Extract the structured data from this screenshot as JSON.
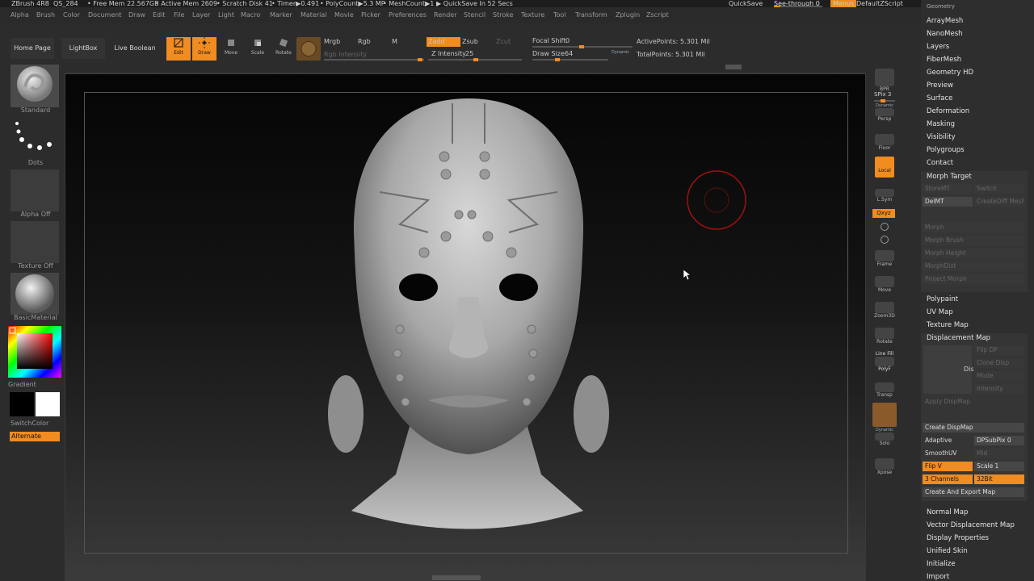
{
  "titlebar": {
    "app": "ZBrush 4R8",
    "project": "QS_284",
    "free_mem": "• Free Mem 22.567GB",
    "active_mem": "• Active Mem 2609",
    "scratch": "• Scratch Disk 41",
    "timer": "• Timer▶0.491",
    "polycount": "• PolyCount▶5.3 MP",
    "meshcount": "• MeshCount▶1",
    "quicksave_in": "▶ QuickSave In 52 Secs",
    "quicksave": "QuickSave",
    "see_through": "See-through  0",
    "menus": "Menus",
    "script": "DefaultZScript"
  },
  "menubar": [
    "Alpha",
    "Brush",
    "Color",
    "Document",
    "Draw",
    "Edit",
    "File",
    "Layer",
    "Light",
    "Macro",
    "Marker",
    "Material",
    "Movie",
    "Picker",
    "Preferences",
    "Render",
    "Stencil",
    "Stroke",
    "Texture",
    "Tool",
    "Transform",
    "Zplugin",
    "Zscript"
  ],
  "toolbar": {
    "home_page": "Home Page",
    "lightbox": "LightBox",
    "live_boolean": "Live Boolean",
    "edit": "Edit",
    "draw": "Draw",
    "move": "Move",
    "scale": "Scale",
    "rotate": "Rotate",
    "mrgb": "Mrgb",
    "rgb": "Rgb",
    "m": "M",
    "rgb_intensity": "Rgb Intensity",
    "zadd": "Zadd",
    "zsub": "Zsub",
    "zcut": "Zcut",
    "z_intensity_label": "Z Intensity",
    "z_intensity_value": "25",
    "focal_shift_label": "Focal Shift",
    "focal_shift_value": "0",
    "draw_size_label": "Draw Size",
    "draw_size_value": "64",
    "dynamic": "Dynamic",
    "active_points": "ActivePoints: 5.301 Mil",
    "total_points": "TotalPoints: 5.301 Mil"
  },
  "leftshelf": {
    "brush": "Standard",
    "stroke": "Dots",
    "alpha": "Alpha Off",
    "texture": "Texture Off",
    "material": "BasicMaterial",
    "gradient": "Gradient",
    "switch_color": "SwitchColor",
    "alternate": "Alternate"
  },
  "rightshelf": {
    "bpr": "BPR",
    "spix_label": "SPix",
    "spix_value": "3",
    "dynamic": "Dynamic",
    "persp": "Persp",
    "floor": "Floor",
    "local": "Local",
    "lsym": "L.Sym",
    "qxyz": "Qxyz",
    "frame": "Frame",
    "move": "Move",
    "zoom3d": "Zoom3D",
    "rotate": "Rotate",
    "line_fill": "Line Fill",
    "polyf": "PolyF",
    "transp": "Transp",
    "dynamic2": "Dynamic",
    "solo": "Solo",
    "xpose": "Xpose"
  },
  "palette": {
    "geometry": "Geometry",
    "items_top": [
      "ArrayMesh",
      "NanoMesh",
      "Layers",
      "FiberMesh",
      "Geometry HD",
      "Preview",
      "Surface",
      "Deformation",
      "Masking",
      "Visibility",
      "Polygroups",
      "Contact"
    ],
    "morph_target": "Morph Target",
    "morph": {
      "storemt": "StoreMT",
      "switch": "Switch",
      "delmt": "DelMT",
      "create_diff_mesh": "CreateDiff Mesh",
      "morph": "Morph",
      "morph_brush": "Morph Brush",
      "morph_height": "Morph Height",
      "morph_dist": "MorphDist",
      "project_morph": "Project Morph"
    },
    "items_mid": [
      "Polypaint",
      "UV Map",
      "Texture Map"
    ],
    "displacement_map": "Displacement Map",
    "disp": {
      "preview": "Dis",
      "flip_dp": "Flip DP",
      "clone_disp": "Clone Disp",
      "mode": "Mode",
      "intensity": "Intensity",
      "apply_dispmap": "Apply DispMap",
      "create_dispmap": "Create DispMap",
      "adaptive": "Adaptive",
      "dpsubpix": "DPSubPix  0",
      "smooth_uv": "SmoothUV",
      "mid": "Mid",
      "flip_v": "Flip V",
      "scale": "Scale  1",
      "channels": "3 Channels",
      "bit": "32Bit",
      "create_export": "Create And Export Map"
    },
    "items_bottom": [
      "Normal Map",
      "Vector Displacement Map",
      "Display Properties",
      "Unified Skin",
      "Initialize",
      "Import"
    ]
  },
  "colors": {
    "accent": "#f08c20",
    "panel": "#2e2e2e"
  }
}
